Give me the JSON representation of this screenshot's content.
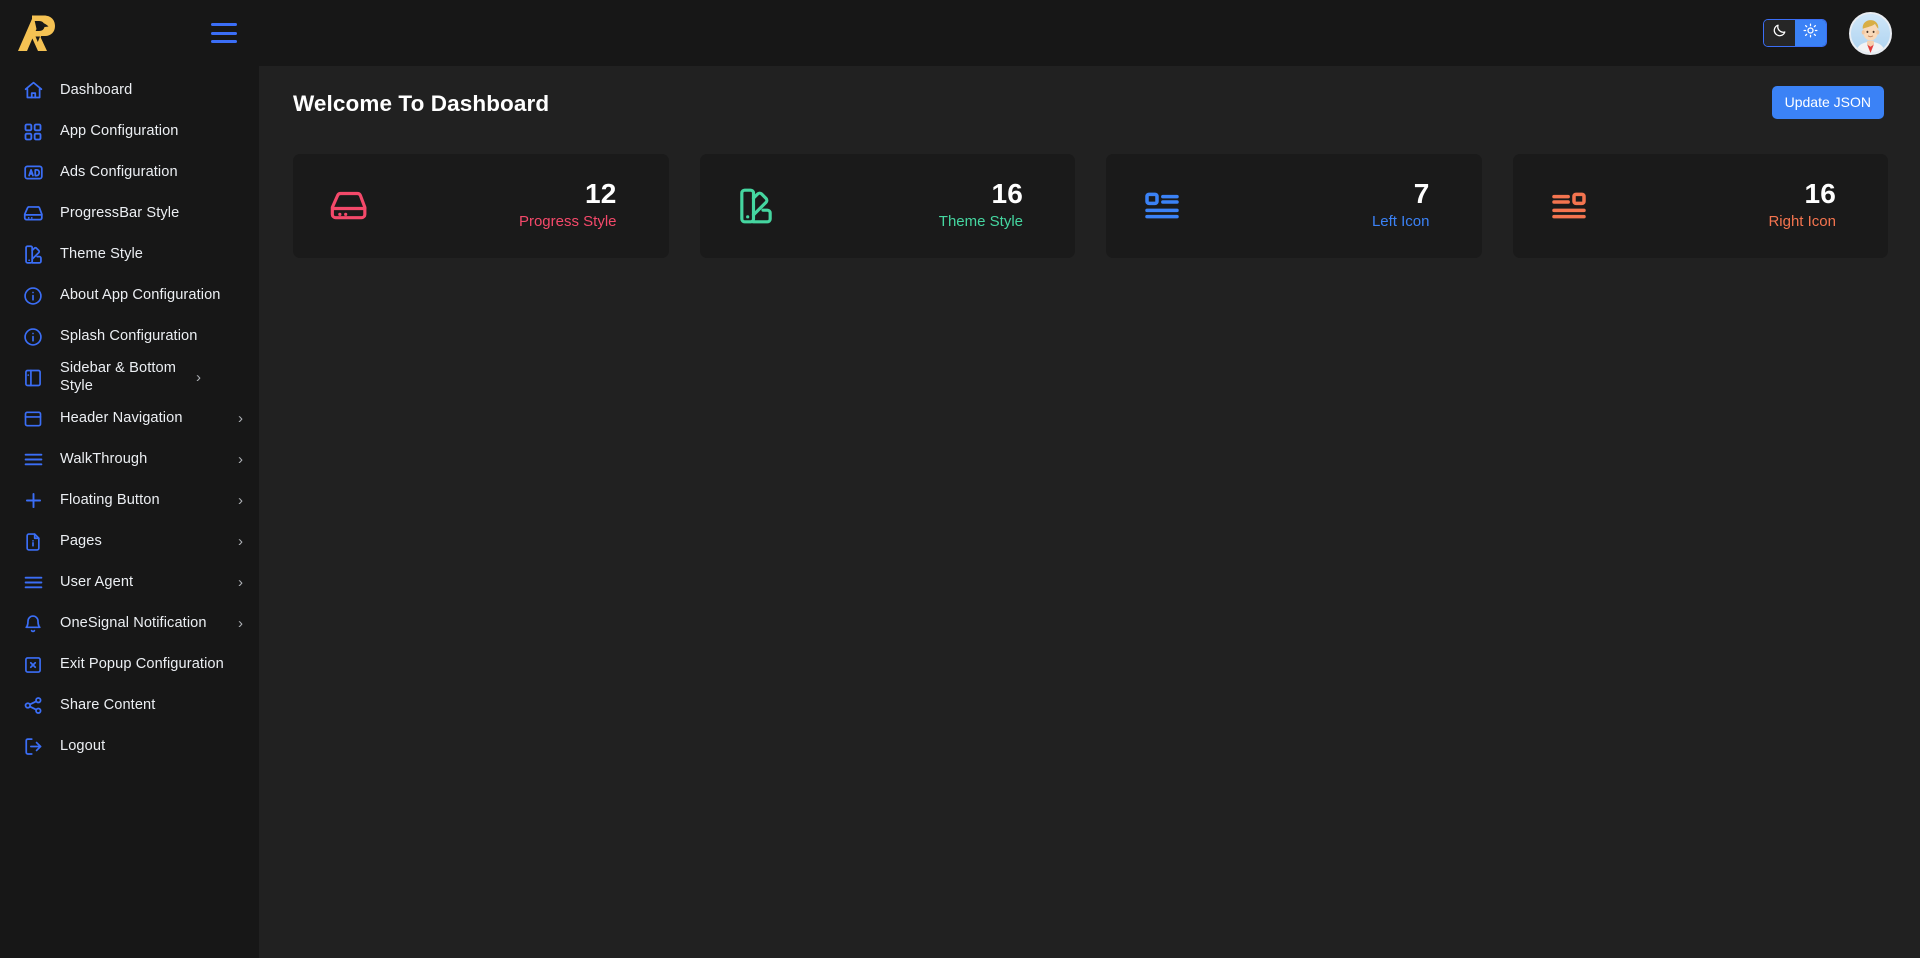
{
  "brand": {
    "logo_icon": "eagle-r-logo",
    "logo_color": "#f5c253",
    "menu_icon": "hamburger-menu-icon"
  },
  "topbar": {
    "theme_toggle": {
      "dark_icon": "moon-icon",
      "light_icon": "sun-icon",
      "active": "light",
      "active_color": "#3b82f6"
    },
    "avatar_alt": "user-avatar"
  },
  "sidebar": {
    "items": [
      {
        "label": "Dashboard",
        "icon": "home-icon",
        "has_submenu": false
      },
      {
        "label": "App Configuration",
        "icon": "grid-icon",
        "has_submenu": false
      },
      {
        "label": "Ads Configuration",
        "icon": "ad-badge-icon",
        "has_submenu": false
      },
      {
        "label": "ProgressBar Style",
        "icon": "hard-drive-icon",
        "has_submenu": false
      },
      {
        "label": "Theme Style",
        "icon": "palette-icon",
        "has_submenu": false
      },
      {
        "label": "About App Configuration",
        "icon": "info-circle-icon",
        "has_submenu": false
      },
      {
        "label": "Splash Configuration",
        "icon": "info-circle-icon",
        "has_submenu": false
      },
      {
        "label": "Sidebar & Bottom Style",
        "icon": "panel-left-icon",
        "has_submenu": true
      },
      {
        "label": "Header Navigation",
        "icon": "panel-top-icon",
        "has_submenu": true
      },
      {
        "label": "WalkThrough",
        "icon": "menu-lines-icon",
        "has_submenu": true
      },
      {
        "label": "Floating Button",
        "icon": "plus-icon",
        "has_submenu": true
      },
      {
        "label": "Pages",
        "icon": "file-info-icon",
        "has_submenu": true
      },
      {
        "label": "User Agent",
        "icon": "menu-lines-icon",
        "has_submenu": true
      },
      {
        "label": "OneSignal Notification",
        "icon": "bell-icon",
        "has_submenu": true
      },
      {
        "label": "Exit Popup Configuration",
        "icon": "box-x-icon",
        "has_submenu": false
      },
      {
        "label": "Share Content",
        "icon": "share-nodes-icon",
        "has_submenu": false
      },
      {
        "label": "Logout",
        "icon": "logout-icon",
        "has_submenu": false
      }
    ],
    "chevron_glyph": "›"
  },
  "main": {
    "page_title": "Welcome To Dashboard",
    "update_button": "Update JSON",
    "stat_cards": [
      {
        "value": "12",
        "label": "Progress Style",
        "icon": "hard-drive-icon",
        "color": "#f4496a"
      },
      {
        "value": "16",
        "label": "Theme Style",
        "icon": "palette-icon",
        "color": "#45d6a0"
      },
      {
        "value": "7",
        "label": "Left Icon",
        "icon": "list-left-icon",
        "color": "#3b82f6"
      },
      {
        "value": "16",
        "label": "Right Icon",
        "icon": "list-right-icon",
        "color": "#f4744f"
      }
    ]
  }
}
